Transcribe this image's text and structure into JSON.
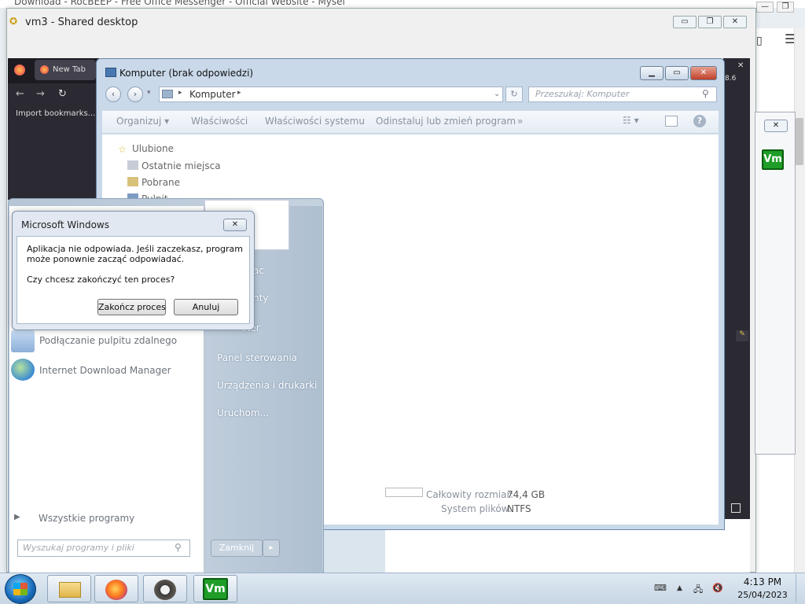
{
  "host": {
    "tab_text": "Download - RocBEEP - Free Office Messenger - Official Website - Mysel",
    "window_buttons": [
      "—",
      "❐",
      "✕"
    ],
    "menu_glyph": "☰",
    "version_text": "8.6"
  },
  "viewer": {
    "title": "vm3 - Shared desktop",
    "buttons": [
      "▭",
      "❐",
      "✕"
    ]
  },
  "firefox": {
    "tab_label": "New Tab",
    "import_label": "Import bookmarks..."
  },
  "explorer": {
    "title": "Komputer (brak odpowiedzi)",
    "address": "Komputer",
    "search_placeholder": "Przeszukaj: Komputer",
    "commands": [
      "Organizuj ▾",
      "Właściwości",
      "Właściwości systemu",
      "Odinstaluj lub zmień program",
      "»"
    ],
    "nav": [
      "Ulubione",
      "Ostatnie miejsca",
      "Pobrane",
      "Pulpit"
    ],
    "details": {
      "total_label": "Całkowity rozmiar:",
      "total_value": "74,4 GB",
      "fs_label": "System plików:",
      "fs_value": "NTFS"
    }
  },
  "start_menu": {
    "programs": [
      "Podłączanie pulpitu zdalnego",
      "Internet Download Manager"
    ],
    "all_programs": "Wszystkie programy",
    "search_placeholder": "Wyszukaj programy i pliki",
    "right_items": [
      "Panel sterowania",
      "Urządzenia i drukarki",
      "Uruchom..."
    ],
    "right_partials": [
      "ac",
      "nty",
      "uter"
    ],
    "shutdown": "Zamknij"
  },
  "dialog": {
    "title": "Microsoft Windows",
    "message": "Aplikacja nie odpowiada. Jeśli zaczekasz, program może ponownie zacząć odpowiadać.",
    "question": "Czy chcesz zakończyć ten proces?",
    "end_button": "Zakończ proces",
    "cancel_button": "Anuluj"
  },
  "vm_badge": "Vm",
  "taskbar": {
    "time": "4:13 PM",
    "date": "25/04/2023"
  }
}
